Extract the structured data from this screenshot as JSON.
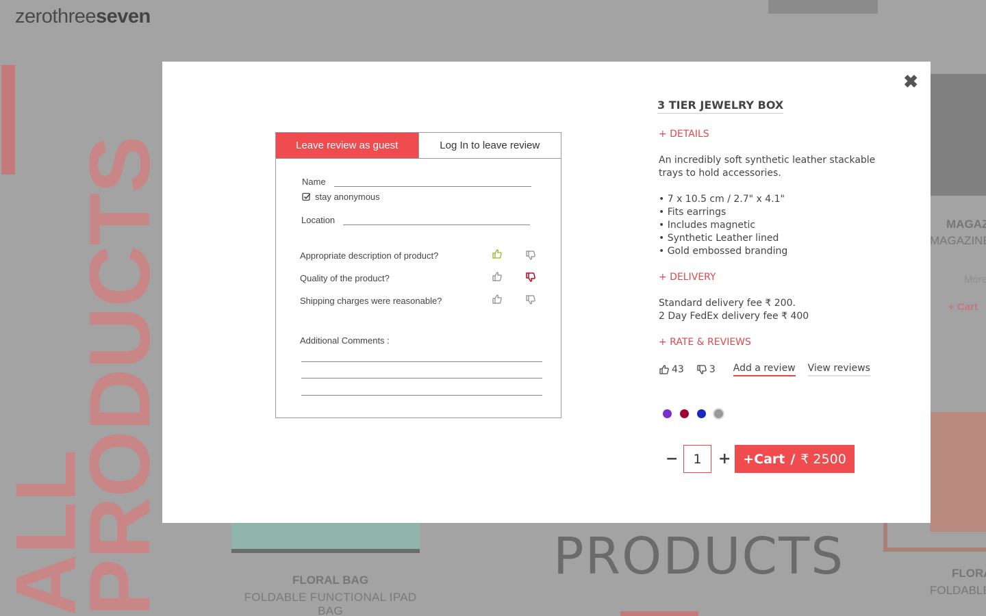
{
  "background": {
    "logo": {
      "part1": "zerothree",
      "part2": "seven"
    },
    "vertical_heading": {
      "line1": "ALL",
      "line2": "PRODUCTS"
    },
    "floral_bag": {
      "name": "FLORAL BAG",
      "subtitle": "FOLDABLE FUNCTIONAL IPAD BAG"
    },
    "products_scrawl": "PRODUCTS",
    "right_col": {
      "title1": "MAGAZ",
      "title2": "MAGAZINE",
      "more": "More",
      "cart": "+ Cart",
      "title3": "FLORA",
      "title4": "FOLDABLE"
    }
  },
  "modal": {
    "close_icon": "close-icon",
    "review": {
      "tab_guest": "Leave review as guest",
      "tab_login": "Log In to leave review",
      "name_label": "Name",
      "anonymous_label": "stay anonymous",
      "anonymous_checked": true,
      "location_label": "Location",
      "questions": [
        {
          "text": "Appropriate description of product?",
          "state": "up"
        },
        {
          "text": "Quality of the product?",
          "state": "down"
        },
        {
          "text": "Shipping charges were reasonable?",
          "state": "none"
        }
      ],
      "comments_label": "Additional Comments :"
    },
    "product": {
      "title": "3 TIER JEWELRY BOX",
      "details_link": "+ DETAILS",
      "description": "An incredibly soft synthetic leather stackable trays to hold accessories.",
      "bullets": [
        "• 7 x 10.5 cm / 2.7\" x 4.1\"",
        "• Fits earrings",
        "• Includes magnetic",
        "• Synthetic Leather lined",
        "• Gold embossed branding"
      ],
      "delivery_link": "+ DELIVERY",
      "delivery_standard": "Standard delivery fee  ₹ 200.",
      "delivery_fedex": "2 Day FedEx delivery fee  ₹ 400",
      "rate_link": "+ RATE & REVIEWS",
      "likes": "43",
      "dislikes": "3",
      "add_review": "Add a review",
      "view_reviews": "View reviews",
      "colors": [
        "#7b2fc9",
        "#a3002f",
        "#1b28c0",
        "#9a9a9a"
      ],
      "quantity": "1",
      "cart_label": "+Cart",
      "cart_sep": "/",
      "price": "₹ 2500"
    }
  }
}
